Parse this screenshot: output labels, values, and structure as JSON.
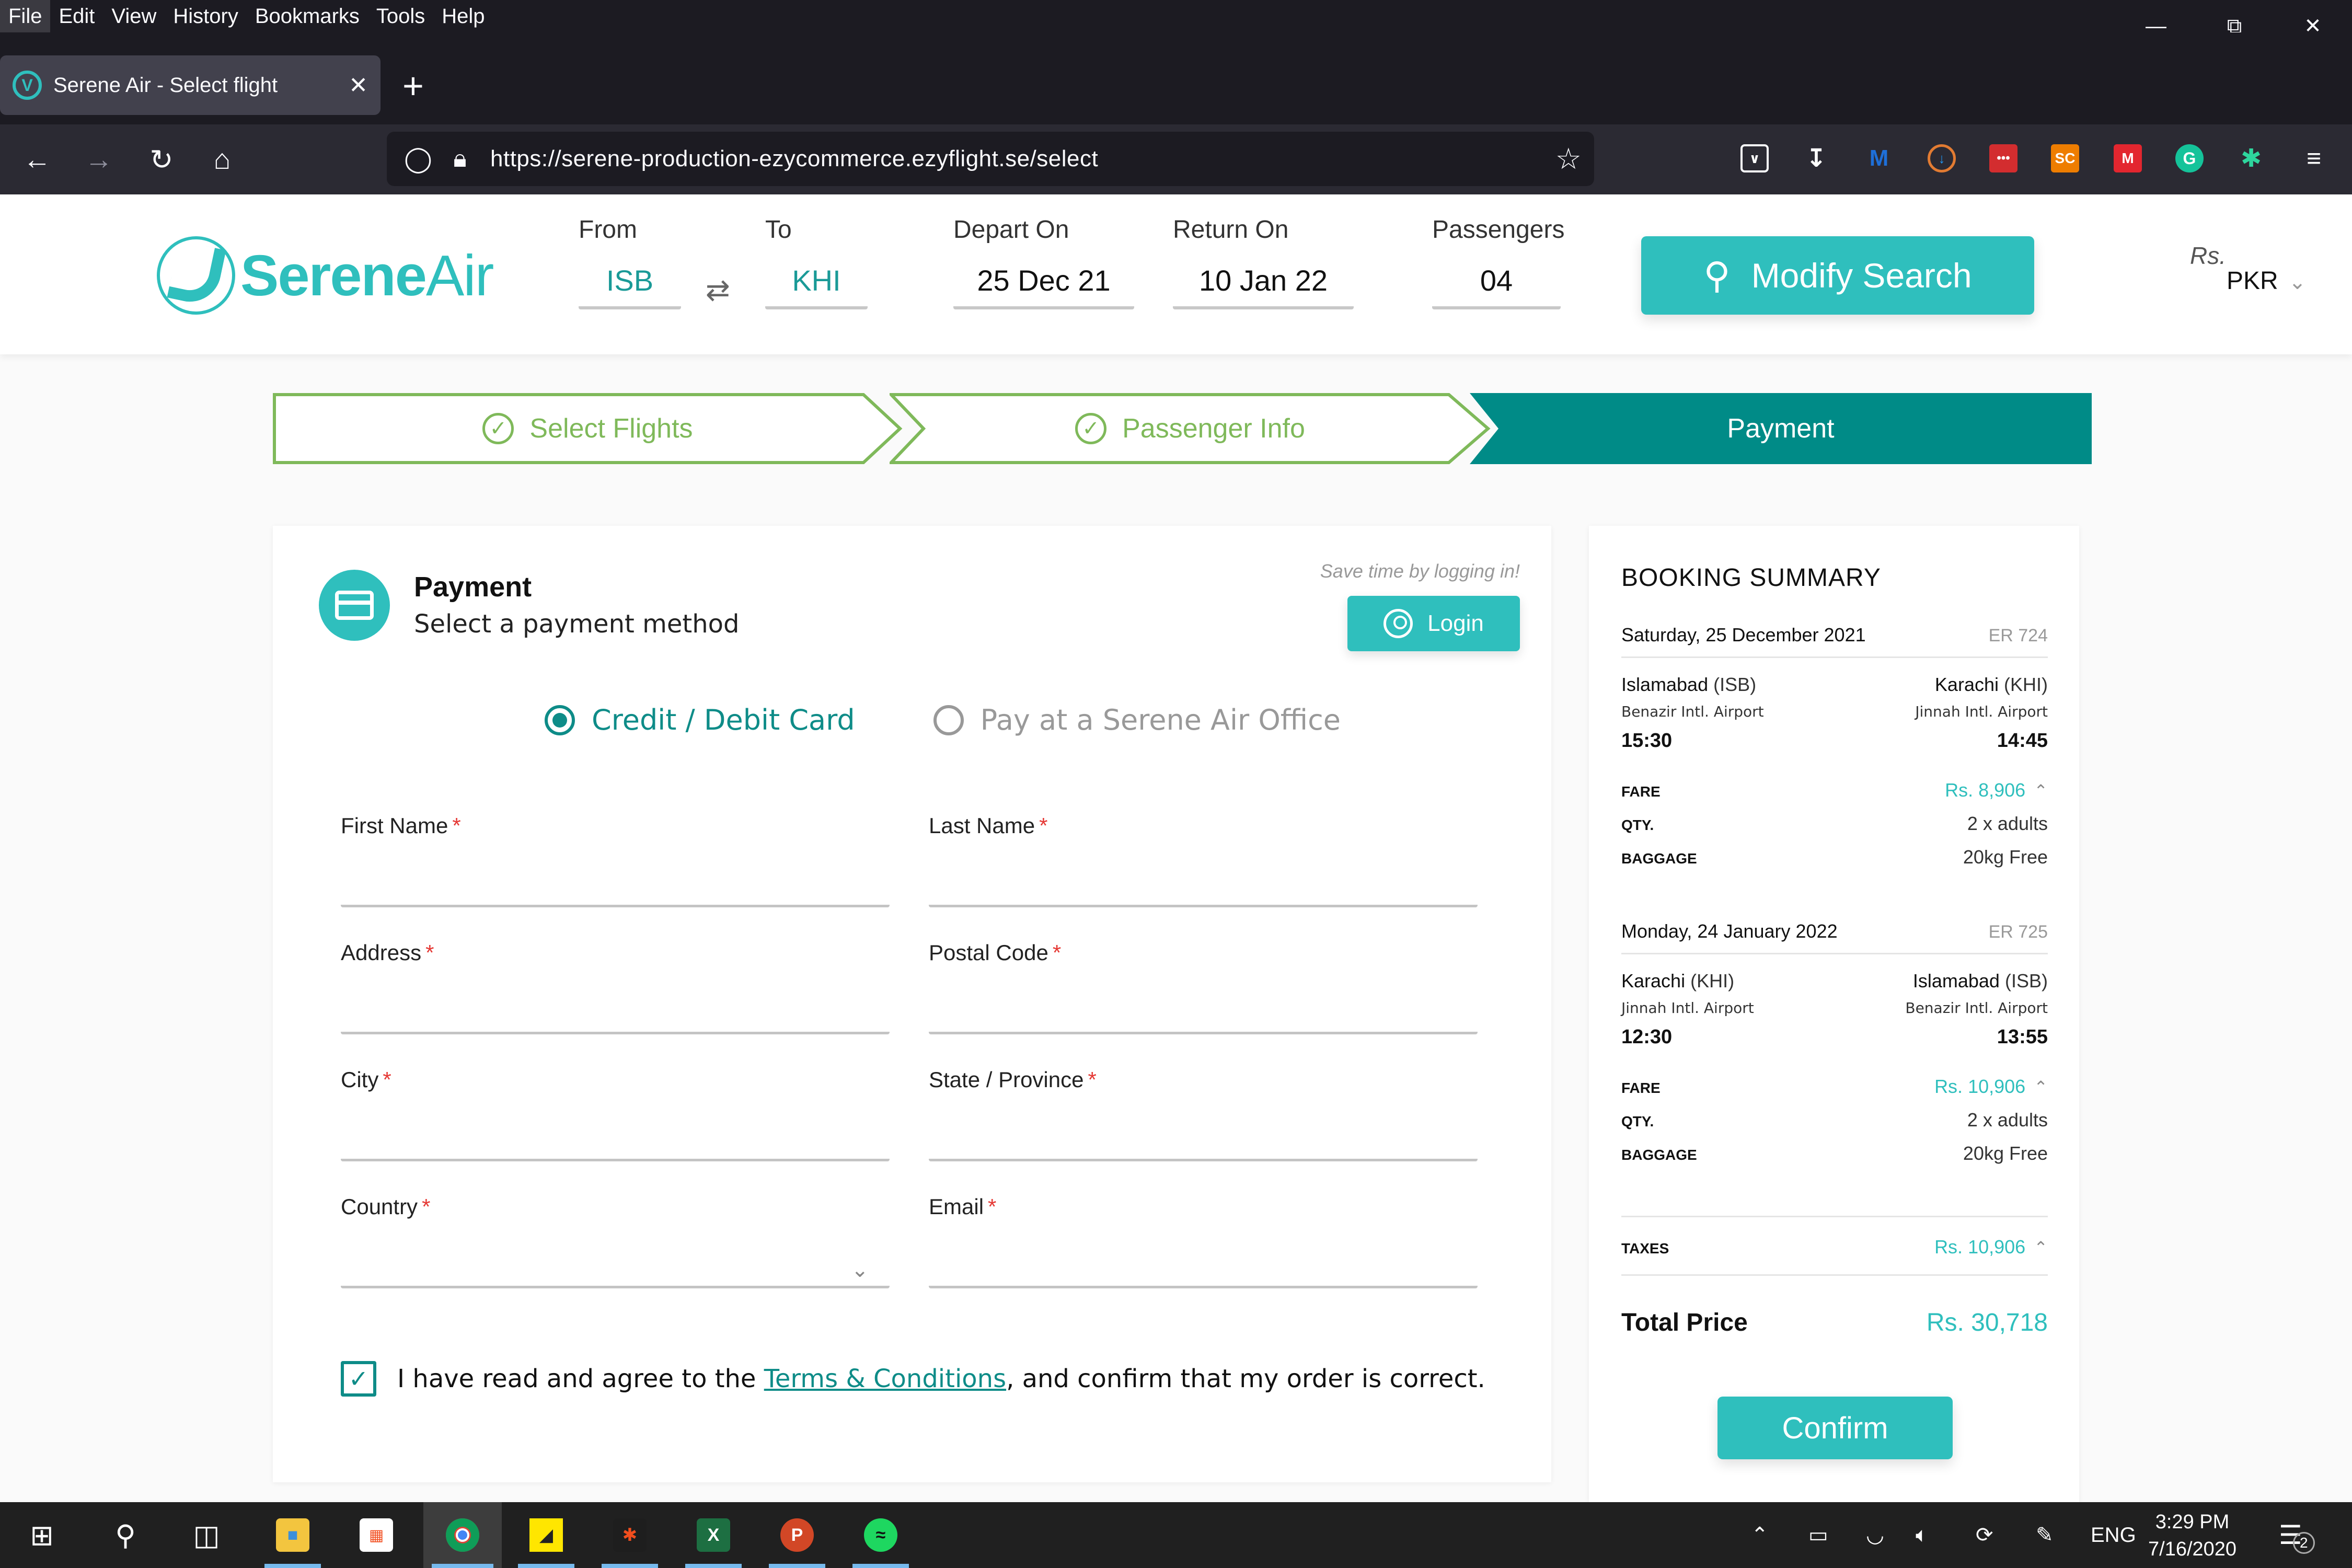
{
  "browser": {
    "menu": [
      "File",
      "Edit",
      "View",
      "History",
      "Bookmarks",
      "Tools",
      "Help"
    ],
    "tab_title": "Serene Air - Select flight",
    "url": "https://serene-production-ezycommerce.ezyflight.se/select",
    "extensions": [
      "pocket-icon",
      "downloads-icon",
      "malwarebytes-icon",
      "extension-blue-icon",
      "lastpass-icon",
      "sc-icon",
      "mendeley-icon",
      "grammarly-icon",
      "runner-extension-icon",
      "menu-icon"
    ]
  },
  "header": {
    "brand": {
      "bold": "Serene",
      "light": "Air"
    },
    "from": {
      "label": "From",
      "value": "ISB"
    },
    "to": {
      "label": "To",
      "value": "KHI"
    },
    "depart": {
      "label": "Depart On",
      "value": "25 Dec 21"
    },
    "return": {
      "label": "Return On",
      "value": "10 Jan 22"
    },
    "passengers": {
      "label": "Passengers",
      "value": "04"
    },
    "modify_label": "Modify Search",
    "currency_symbol": "Rs.",
    "currency": "PKR"
  },
  "steps": [
    {
      "label": "Select Flights",
      "state": "done"
    },
    {
      "label": "Passenger Info",
      "state": "done"
    },
    {
      "label": "Payment",
      "state": "active"
    }
  ],
  "payment": {
    "title": "Payment",
    "subtitle": "Select a payment method",
    "save_time": "Save time by logging in!",
    "login_label": "Login",
    "methods": [
      {
        "label": "Credit / Debit Card",
        "selected": true
      },
      {
        "label": "Pay at a Serene Air Office",
        "selected": false
      }
    ],
    "fields": [
      {
        "label": "First Name",
        "required": "*",
        "value": ""
      },
      {
        "label": "Last Name",
        "required": "*",
        "value": ""
      },
      {
        "label": "Address",
        "required": "*",
        "value": ""
      },
      {
        "label": "Postal Code",
        "required": "*",
        "value": ""
      },
      {
        "label": "City",
        "required": "*",
        "value": ""
      },
      {
        "label": "State / Province",
        "required": "*",
        "value": ""
      },
      {
        "label": "Country",
        "required": "*",
        "value": ""
      },
      {
        "label": "Email",
        "required": "*",
        "value": ""
      }
    ],
    "agree": {
      "checked": true,
      "before": "I have read and agree to the ",
      "link": "Terms & Conditions",
      "after": ", and confirm that my order is correct."
    }
  },
  "summary": {
    "title": "BOOKING SUMMARY",
    "flights": [
      {
        "date": "Saturday, 25 December 2021",
        "flight_no": "ER 724",
        "from_city": "Islamabad",
        "from_code": "(ISB)",
        "from_airport": "Benazir Intl. Airport",
        "dep_time": "15:30",
        "to_city": "Karachi",
        "to_code": "(KHI)",
        "to_airport": "Jinnah Intl. Airport",
        "arr_time": "14:45",
        "fare_label": "FARE",
        "fare": "Rs. 8,906",
        "qty_label": "QTY.",
        "qty": "2 x adults",
        "baggage_label": "BAGGAGE",
        "baggage": "20kg Free"
      },
      {
        "date": "Monday, 24 January 2022",
        "flight_no": "ER 725",
        "from_city": "Karachi",
        "from_code": "(KHI)",
        "from_airport": "Jinnah Intl. Airport",
        "dep_time": "12:30",
        "to_city": "Islamabad",
        "to_code": "(ISB)",
        "to_airport": "Benazir Intl. Airport",
        "arr_time": "13:55",
        "fare_label": "FARE",
        "fare": "Rs. 10,906",
        "qty_label": "QTY.",
        "qty": "2 x adults",
        "baggage_label": "BAGGAGE",
        "baggage": "20kg Free"
      }
    ],
    "taxes_label": "TAXES",
    "taxes": "Rs. 10,906",
    "total_label": "Total Price",
    "total": "Rs. 30,718",
    "confirm_label": "Confirm"
  },
  "taskbar": {
    "apps": [
      "file-explorer",
      "microsoft-store",
      "chrome",
      "sticky-notes",
      "figma",
      "excel",
      "powerpoint",
      "spotify"
    ],
    "language": "ENG",
    "time": "3:29 PM",
    "date": "7/16/2020",
    "notification_count": "2"
  },
  "colors": {
    "brand_teal": "#2fbfbd",
    "dark_teal": "#0e8c88",
    "step_green": "#7fb95a",
    "required_red": "#e53935"
  }
}
